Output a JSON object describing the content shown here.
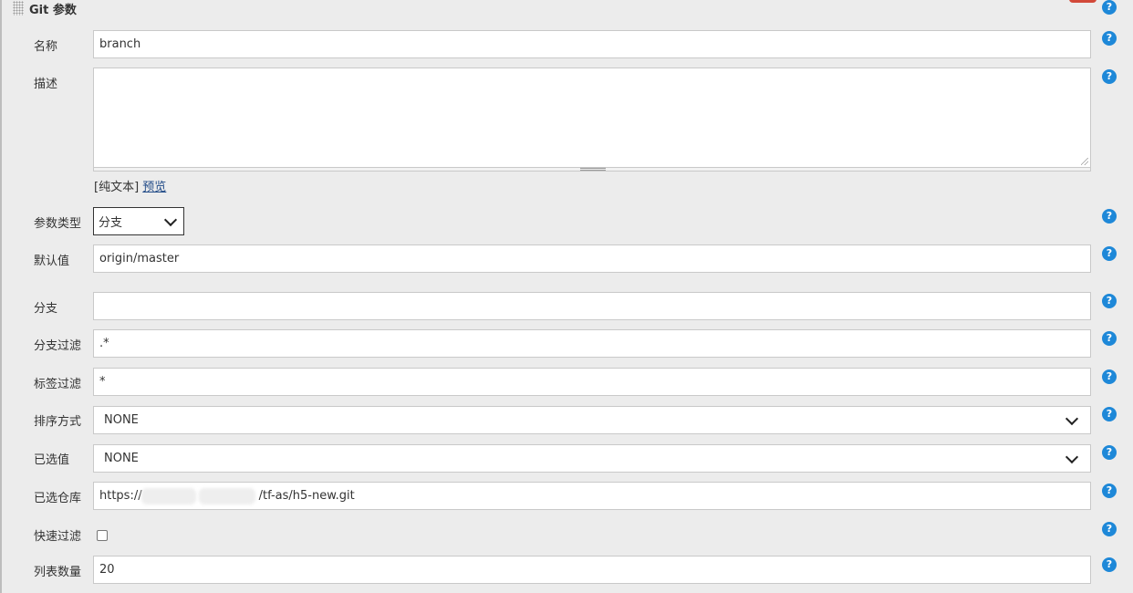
{
  "section": {
    "title": "Git 参数"
  },
  "help_glyph": "?",
  "colors": {
    "help_icon": "#1e88d8",
    "delete_button": "#d24939",
    "link": "#204a87"
  },
  "fields": {
    "name": {
      "label": "名称",
      "value": "branch"
    },
    "description": {
      "label": "描述",
      "value": "",
      "format_plain": "[纯文本]",
      "preview_link": "预览"
    },
    "param_type": {
      "label": "参数类型",
      "value": "分支"
    },
    "default_value": {
      "label": "默认值",
      "value": "origin/master"
    },
    "branch": {
      "label": "分支",
      "value": ""
    },
    "branch_filter": {
      "label": "分支过滤",
      "value": ".*"
    },
    "tag_filter": {
      "label": "标签过滤",
      "value": "*"
    },
    "sort_mode": {
      "label": "排序方式",
      "value": "NONE"
    },
    "selected_value": {
      "label": "已选值",
      "value": "NONE"
    },
    "selected_repo": {
      "label": "已选仓库",
      "value_prefix": "https://",
      "value_suffix": "/tf-as/h5-new.git"
    },
    "quick_filter": {
      "label": "快速过滤",
      "checked": false
    },
    "list_size": {
      "label": "列表数量",
      "value": "20"
    }
  }
}
